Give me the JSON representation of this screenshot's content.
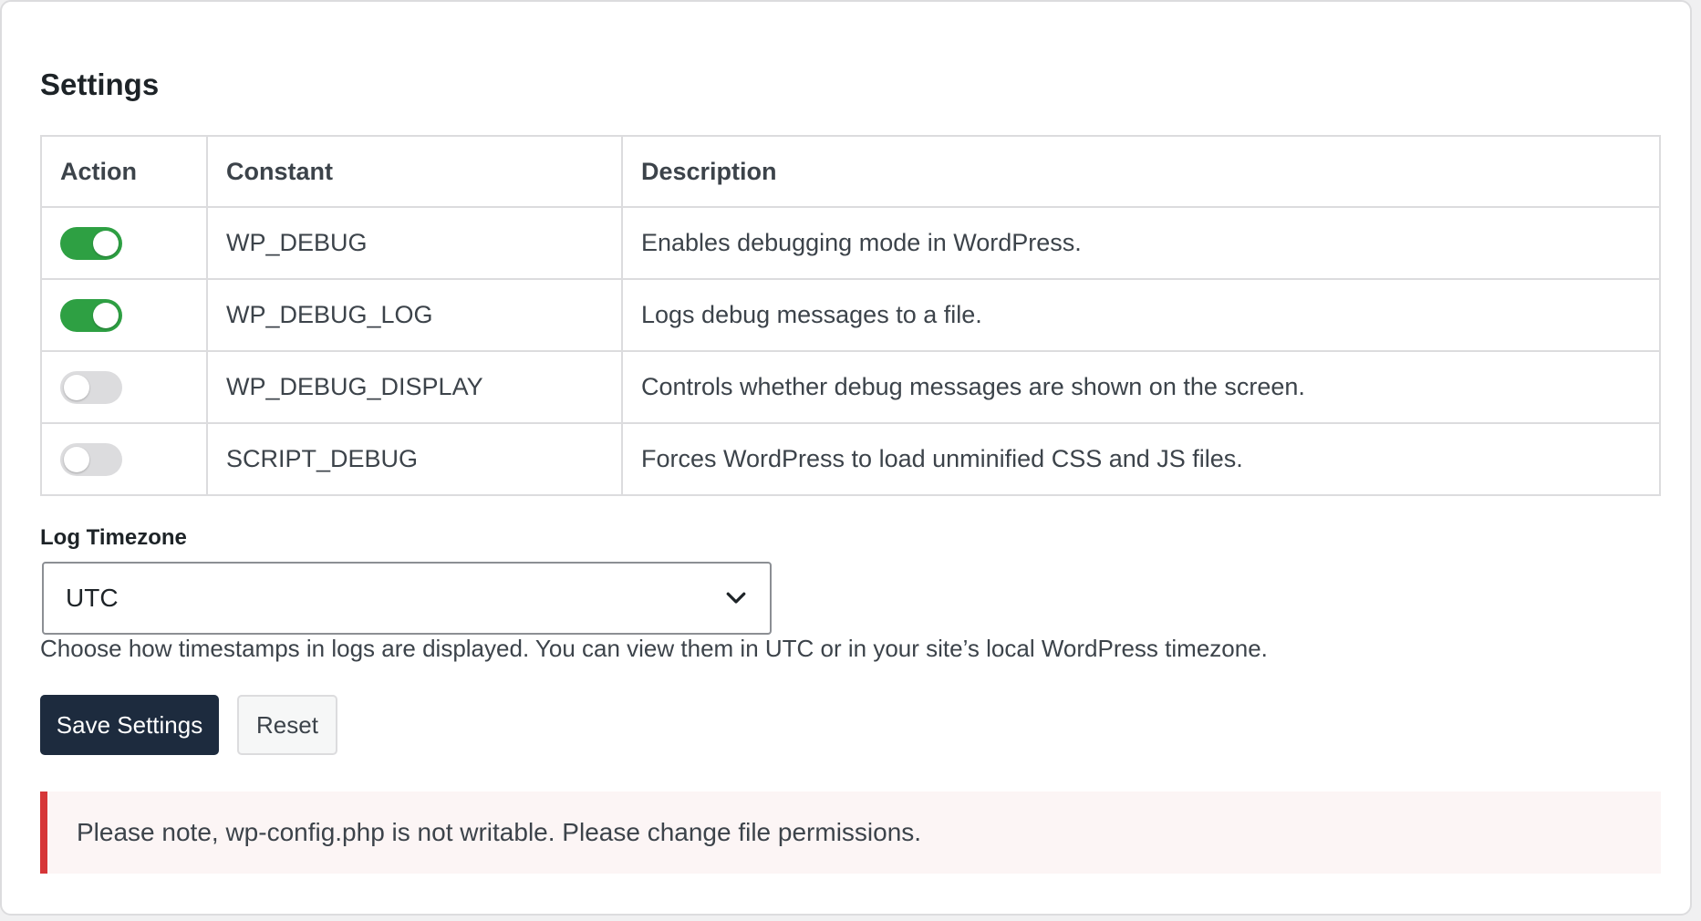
{
  "settings": {
    "title": "Settings",
    "table": {
      "headers": [
        "Action",
        "Constant",
        "Description"
      ],
      "rows": [
        {
          "enabled": true,
          "constant": "WP_DEBUG",
          "description": "Enables debugging mode in WordPress."
        },
        {
          "enabled": true,
          "constant": "WP_DEBUG_LOG",
          "description": "Logs debug messages to a file."
        },
        {
          "enabled": false,
          "constant": "WP_DEBUG_DISPLAY",
          "description": "Controls whether debug messages are shown on the screen."
        },
        {
          "enabled": false,
          "constant": "SCRIPT_DEBUG",
          "description": "Forces WordPress to load unminified CSS and JS files."
        }
      ]
    },
    "timezone": {
      "label": "Log Timezone",
      "selected": "UTC",
      "help": "Choose how timestamps in logs are displayed. You can view them in UTC or in your site’s local WordPress timezone."
    },
    "buttons": {
      "save": "Save Settings",
      "reset": "Reset"
    },
    "notice": "Please note, wp-config.php is not writable. Please change file permissions."
  },
  "colors": {
    "toggle_on": "#2ea043",
    "toggle_off": "#dcdcde",
    "primary_button": "#1d2b3e",
    "notice_border": "#d63638",
    "notice_bg": "#fcf5f5"
  },
  "icons": {
    "select_chevron": "chevron-down-icon"
  }
}
